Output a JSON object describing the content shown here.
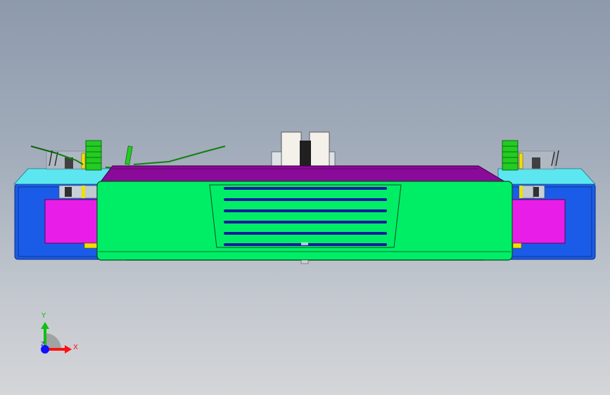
{
  "viewport": {
    "model_view": "front",
    "colors": {
      "background_top": "#8d9aac",
      "background_bottom": "#d4d6d8",
      "body_green": "#00ee66",
      "top_plate_purple": "#8a0a9a",
      "side_blue": "#1a5ce8",
      "magenta_block": "#e81ee8",
      "cyan_plate": "#5ce6f0",
      "spring_green": "#22cc22",
      "yellow_pin": "#f0e000",
      "slot_blue": "#1a1aa0"
    }
  },
  "triad": {
    "x_label": "X",
    "y_label": "Y",
    "z_label": "Z",
    "x_color": "#ff1010",
    "y_color": "#10c010",
    "z_color": "#1010ff"
  }
}
